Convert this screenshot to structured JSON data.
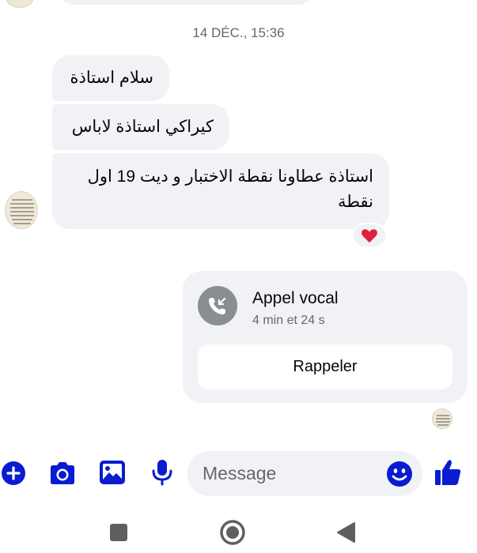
{
  "conversation": {
    "timestamp": "14 DÉC., 15:36",
    "messages": [
      {
        "text": "سلام استاذة"
      },
      {
        "text": "كيراكي استاذة لاباس"
      },
      {
        "text": "استاذة عطاونا نقطة الاختبار و ديت 19 اول نقطة"
      }
    ],
    "reaction": "heart"
  },
  "call": {
    "title": "Appel vocal",
    "duration": "4 min et 24 s",
    "callback_label": "Rappeler"
  },
  "composer": {
    "placeholder": "Message",
    "icons": [
      "plus-icon",
      "camera-icon",
      "gallery-icon",
      "microphone-icon",
      "emoji-icon",
      "thumbs-up-icon"
    ]
  },
  "colors": {
    "accent": "#0a1bd1",
    "bubble": "#f0f2f5",
    "secondary_text": "#65676b",
    "reaction": "#e41e3f",
    "nav": "#5f5f5f"
  }
}
